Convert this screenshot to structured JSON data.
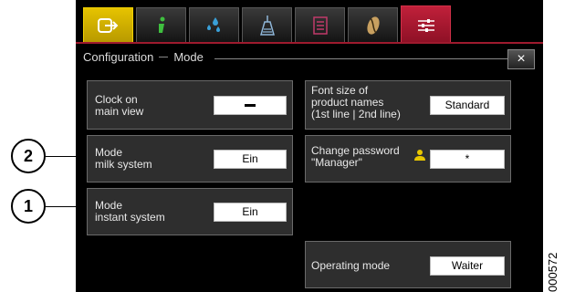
{
  "tabs": [
    {
      "name": "home-tab",
      "icon": "logout-icon"
    },
    {
      "name": "info-tab",
      "icon": "info-icon"
    },
    {
      "name": "care-tab",
      "icon": "drops-icon"
    },
    {
      "name": "cleaning-tab",
      "icon": "cleaning-icon"
    },
    {
      "name": "list-tab",
      "icon": "list-icon"
    },
    {
      "name": "coffee-tab",
      "icon": "bean-icon"
    },
    {
      "name": "settings-tab",
      "icon": "sliders-icon",
      "selected": true
    }
  ],
  "header": {
    "section": "Configuration",
    "subsection": "Mode",
    "close_label": "×"
  },
  "settings": {
    "clock": {
      "label": "Clock on\nmain view",
      "value": "—"
    },
    "milk": {
      "label": "Mode\nmilk system",
      "value": "Ein"
    },
    "instant": {
      "label": "Mode\ninstant system",
      "value": "Ein"
    },
    "font": {
      "label": "Font size of\nproduct names\n(1st line | 2nd line)",
      "value": "Standard"
    },
    "password": {
      "label": "Change password\n\"Manager\"",
      "value": "*"
    },
    "operating": {
      "label": "Operating mode",
      "value": "Waiter"
    }
  },
  "callouts": {
    "one": "1",
    "two": "2"
  },
  "doc_id": "000572",
  "colors": {
    "accent_tab": "#b0182e",
    "home_tab": "#d4b400",
    "panel": "#2e2e2e"
  }
}
